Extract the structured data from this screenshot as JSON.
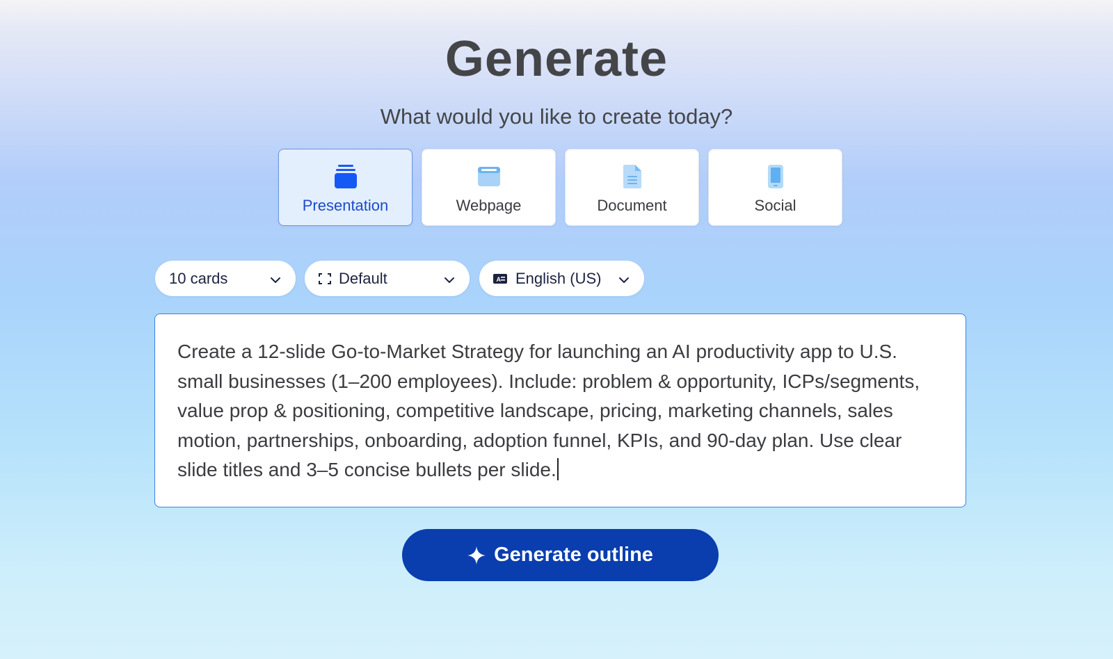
{
  "header": {
    "title": "Generate",
    "subtitle": "What would you like to create today?"
  },
  "types": [
    {
      "label": "Presentation",
      "icon": "stacked-slides-icon",
      "selected": true
    },
    {
      "label": "Webpage",
      "icon": "browser-window-icon",
      "selected": false
    },
    {
      "label": "Document",
      "icon": "document-icon",
      "selected": false
    },
    {
      "label": "Social",
      "icon": "phone-icon",
      "selected": false
    }
  ],
  "options": {
    "cards": {
      "value": "10 cards",
      "icon": "chevron-down-icon"
    },
    "layout": {
      "value": "Default",
      "icon": "aspect-ratio-icon"
    },
    "language": {
      "value": "English (US)",
      "icon": "language-icon"
    }
  },
  "prompt": {
    "value": "Create a 12-slide Go-to-Market Strategy for launching an AI productivity app to U.S. small businesses (1–200 employees). Include: problem & opportunity, ICPs/segments, value prop & positioning, competitive landscape, pricing, marketing channels, sales motion, partnerships, onboarding, adoption funnel, KPIs, and 90-day plan. Use clear slide titles and 3–5 concise bullets per slide."
  },
  "action": {
    "label": "Generate outline",
    "icon": "sparkle-icon"
  },
  "colors": {
    "accent": "#0a3eaf",
    "selected_card_bg": "#e4effd",
    "selected_text": "#1a4bc9",
    "prompt_border": "#3f7ee8"
  }
}
